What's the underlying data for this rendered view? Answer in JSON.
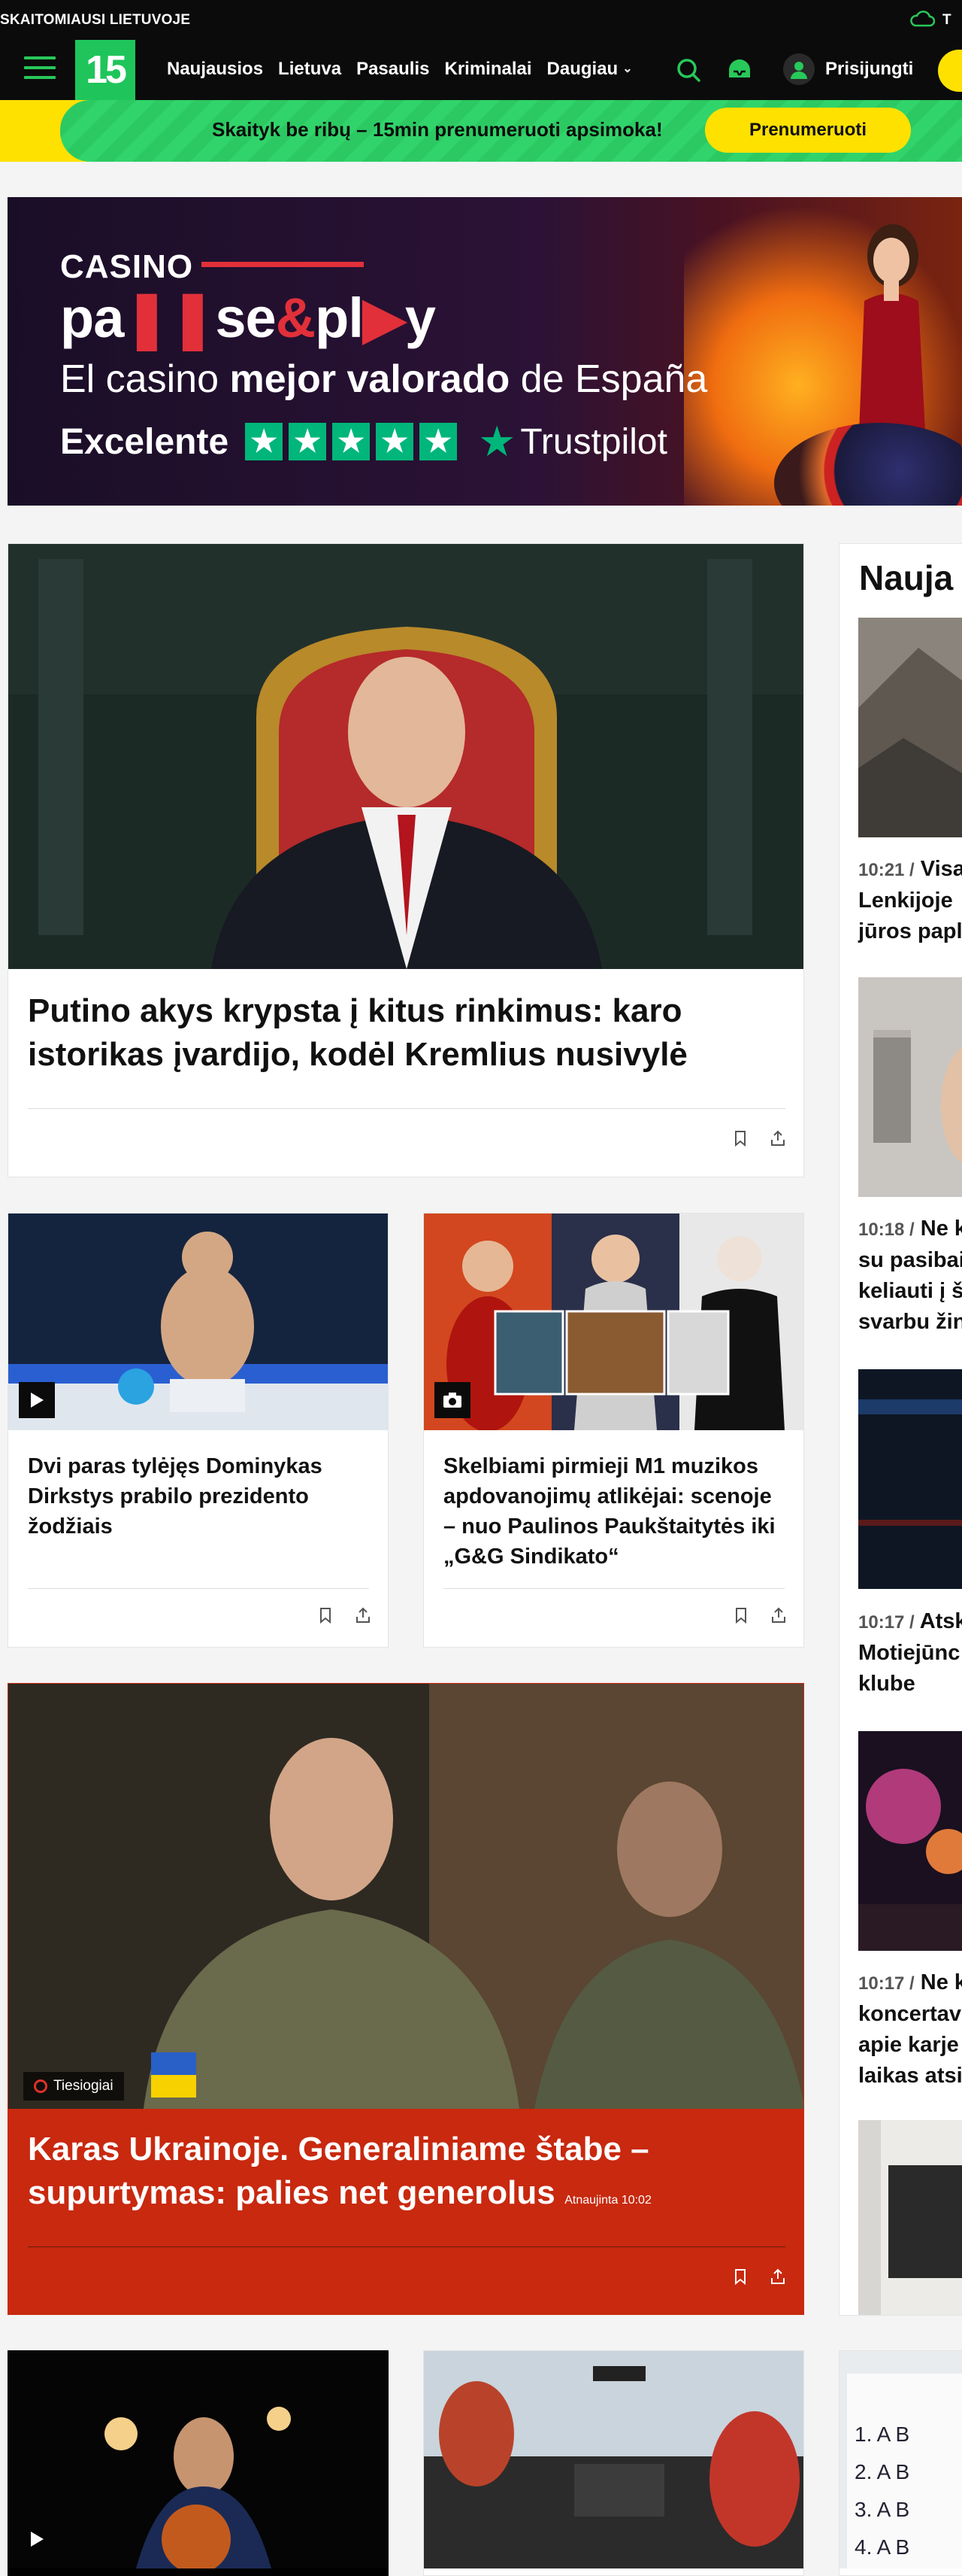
{
  "topstrip": {
    "text": "SKAITOMIAUSI LIETUVOJE",
    "right": "T"
  },
  "nav": {
    "logo": "15",
    "links": [
      "Naujausios",
      "Lietuva",
      "Pasaulis",
      "Kriminalai",
      "Daugiau"
    ],
    "login": "Prisijungti",
    "icons": [
      "menu-icon",
      "search-icon",
      "inbox-icon",
      "user-icon",
      "chevron-down-icon"
    ]
  },
  "promo": {
    "text": "Skaityk be ribų – 15min prenumeruoti apsimoka!",
    "button": "Prenumeruoti"
  },
  "ad": {
    "casino": "CASINO",
    "brand_a": "pa",
    "brand_b": "se",
    "brand_amp": "&",
    "brand_c": "pl",
    "brand_d": "y",
    "line_pre": "El casino ",
    "line_bold": "mejor valorado",
    "line_post": " de España",
    "excellent": "Excelente",
    "trustpilot": "Trustpilot"
  },
  "articles": {
    "main": {
      "title": "Putino akys krypsta į kitus rinkimus: karo istorikas įvardijo, kodėl Kremlius nusivylė"
    },
    "a1": {
      "title": "Dvi paras tylėjęs Dominykas Dirkstys prabilo prezidento žodžiais"
    },
    "a2": {
      "title": "Skelbiami pirmieji M1 muzikos apdovanojimų atlikėjai: scenoje – nuo Paulinos Paukštaitytės iki „G&G Sindikato“"
    },
    "live": {
      "badge": "Tiesiogiai",
      "title": "Karas Ukrainoje. Generaliniame štabe – supurtymas: palies net generolus",
      "updated": "Atnaujinta 10:02"
    }
  },
  "sidebar": {
    "title": "Nauja",
    "items": [
      {
        "time": "10:21 /",
        "lines": [
          "Visas",
          "Lenkijoje",
          "jūros papl"
        ]
      },
      {
        "time": "10:18 /",
        "lines": [
          "Ne k",
          "su pasibai",
          "keliauti į š",
          "svarbu žin"
        ]
      },
      {
        "time": "10:17 /",
        "lines": [
          "Atski",
          "Motiejūnc",
          "klube"
        ]
      },
      {
        "time": "10:17 /",
        "lines": [
          "Ne ka",
          "koncertav",
          "apie karje",
          "laikas atsi"
        ]
      }
    ]
  },
  "colors": {
    "brand_green": "#1fc55b",
    "promo_yellow": "#ffe100",
    "live_red": "#c8290f"
  }
}
